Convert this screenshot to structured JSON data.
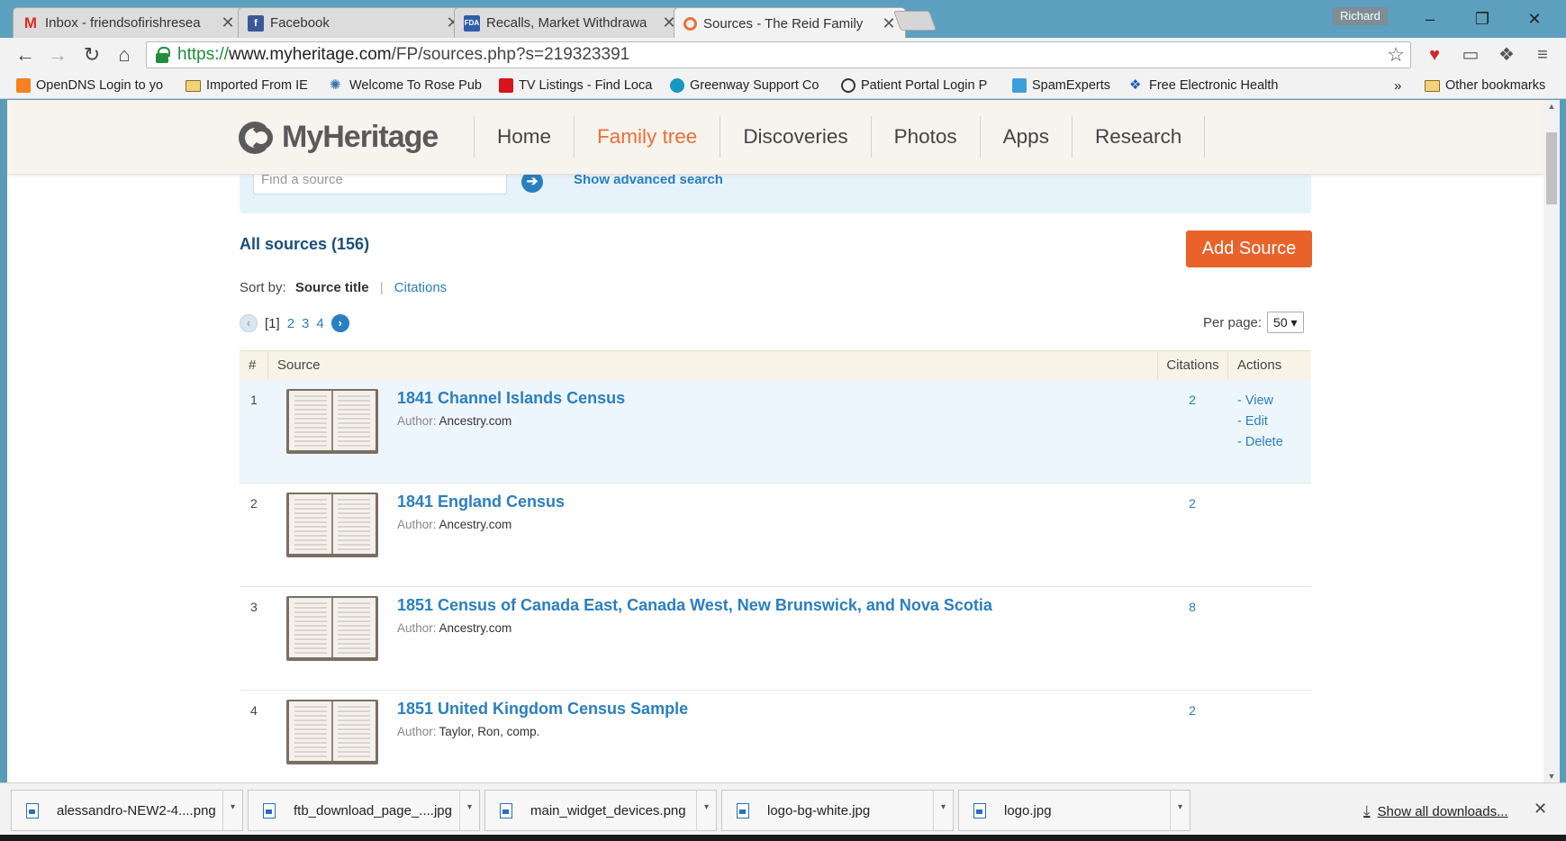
{
  "browser": {
    "tabs": [
      {
        "title": "Inbox - friendsofirishresea",
        "favicon": "gmail-icon",
        "close": "✕"
      },
      {
        "title": "Facebook",
        "favicon": "facebook-icon",
        "close": "✕"
      },
      {
        "title": "Recalls, Market Withdrawa",
        "favicon": "fda-icon",
        "close": "✕"
      },
      {
        "title": "Sources - The Reid Family",
        "favicon": "myheritage-icon",
        "close": "✕",
        "active": true
      }
    ],
    "profile_name": "Richard",
    "window_controls": {
      "minimize": "–",
      "restore": "❐",
      "close": "✕"
    },
    "url_scheme": "https://",
    "url_host": "www.myheritage.com",
    "url_path": "/FP/sources.php?s=219323391",
    "bookmarks": [
      {
        "label": "OpenDNS Login to yo",
        "icon": "opendns-icon"
      },
      {
        "label": "Imported From IE",
        "icon": "folder-icon"
      },
      {
        "label": "Welcome To Rose Pub",
        "icon": "gear-icon"
      },
      {
        "label": "TV Listings - Find Loca",
        "icon": "tv-icon"
      },
      {
        "label": "Greenway Support Co",
        "icon": "salesforce-icon"
      },
      {
        "label": "Patient Portal Login P",
        "icon": "portal-icon"
      },
      {
        "label": "SpamExperts",
        "icon": "spamexperts-icon"
      },
      {
        "label": "Free Electronic Health",
        "icon": "dropbox-icon"
      }
    ],
    "bookmarks_overflow": "»",
    "other_bookmarks": "Other bookmarks"
  },
  "site": {
    "logo_text": "MyHeritage",
    "nav": [
      {
        "label": "Home",
        "active": false
      },
      {
        "label": "Family tree",
        "active": true
      },
      {
        "label": "Discoveries",
        "active": false
      },
      {
        "label": "Photos",
        "active": false
      },
      {
        "label": "Apps",
        "active": false
      },
      {
        "label": "Research",
        "active": false
      }
    ],
    "accent_color": "#e8713a",
    "link_color": "#2a7fc0"
  },
  "search": {
    "placeholder": "Find a source",
    "go_icon": "➔",
    "advanced_label": "Show advanced search"
  },
  "sources": {
    "heading": "All sources (156)",
    "add_button": "Add Source",
    "sort_label": "Sort by:",
    "sort_current": "Source title",
    "sort_separator": "|",
    "sort_other": "Citations",
    "pager": {
      "prev": "‹",
      "current": "[1]",
      "pages": [
        "2",
        "3",
        "4"
      ],
      "next": "›"
    },
    "per_page_label": "Per page:",
    "per_page_value": "50 ▾",
    "columns": {
      "num": "#",
      "source": "Source",
      "citations": "Citations",
      "actions": "Actions"
    },
    "author_label": "Author:",
    "actions": [
      "- View",
      "- Edit",
      "- Delete"
    ],
    "rows": [
      {
        "num": "1",
        "title": "1841 Channel Islands Census",
        "author": "Ancestry.com",
        "citations": "2"
      },
      {
        "num": "2",
        "title": "1841 England Census",
        "author": "Ancestry.com",
        "citations": "2"
      },
      {
        "num": "3",
        "title": "1851 Census of Canada East, Canada West, New Brunswick, and Nova Scotia",
        "author": "Ancestry.com",
        "citations": "8"
      },
      {
        "num": "4",
        "title": "1851 United Kingdom Census Sample",
        "author": "Taylor, Ron, comp.",
        "citations": "2"
      }
    ]
  },
  "downloads": {
    "items": [
      "alessandro-NEW2-4....png",
      "ftb_download_page_....jpg",
      "main_widget_devices.png",
      "logo-bg-white.jpg",
      "logo.jpg"
    ],
    "dropdown": "▾",
    "show_all": "Show all downloads...",
    "close": "✕"
  }
}
